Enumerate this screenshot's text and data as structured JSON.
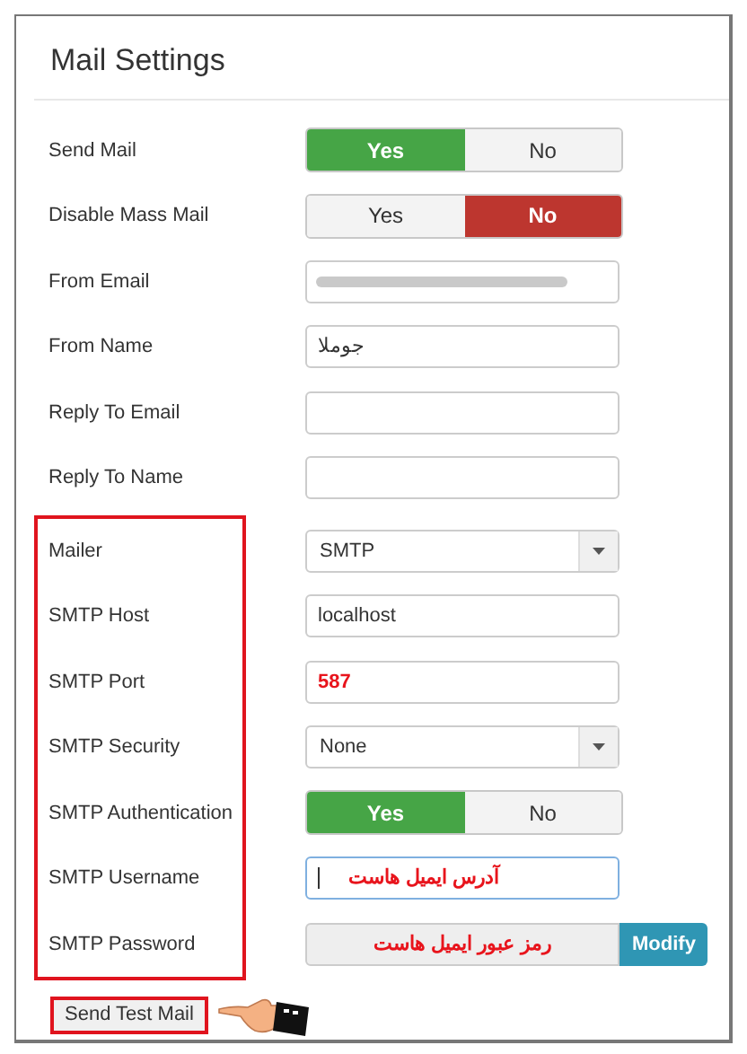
{
  "title": "Mail Settings",
  "sections": [
    {
      "highlighted": false,
      "fields": [
        {
          "kind": "toggle",
          "label": "Send Mail",
          "color": "#46a546",
          "options": [
            {
              "label": "Yes",
              "selected": true
            },
            {
              "label": "No",
              "selected": false
            }
          ]
        },
        {
          "kind": "toggle",
          "label": "Disable Mass Mail",
          "color": "#bd362f",
          "options": [
            {
              "label": "Yes",
              "selected": false
            },
            {
              "label": "No",
              "selected": true
            }
          ]
        },
        {
          "kind": "blurred",
          "label": "From Email"
        },
        {
          "kind": "text",
          "label": "From Name",
          "value": "جوملا",
          "focused": false
        },
        {
          "kind": "text",
          "label": "Reply To Email",
          "focused": false
        },
        {
          "kind": "text",
          "label": "Reply To Name",
          "focused": false
        }
      ]
    },
    {
      "highlighted": true,
      "fields": [
        {
          "kind": "select",
          "label": "Mailer",
          "value": "SMTP"
        },
        {
          "kind": "text",
          "label": "SMTP Host",
          "value": "localhost",
          "focused": false
        },
        {
          "kind": "text",
          "label": "SMTP Port",
          "value": "587",
          "color": "#e8141c",
          "focused": false
        },
        {
          "kind": "select",
          "label": "SMTP Security",
          "value": "None"
        },
        {
          "kind": "toggle",
          "label": "SMTP Authentication",
          "color": "#46a546",
          "options": [
            {
              "label": "Yes",
              "selected": true
            },
            {
              "label": "No",
              "selected": false
            }
          ]
        },
        {
          "kind": "text",
          "label": "SMTP Username",
          "value": "آدرس ایمیل هاست",
          "color": "#e8141c",
          "focused": true
        },
        {
          "kind": "password",
          "label": "SMTP Password",
          "value": "رمز عبور ایمیل هاست",
          "color": "#e8141c",
          "button": "Modify"
        }
      ]
    }
  ],
  "test_button": {
    "label": "Send Test Mail",
    "highlighted": true
  }
}
